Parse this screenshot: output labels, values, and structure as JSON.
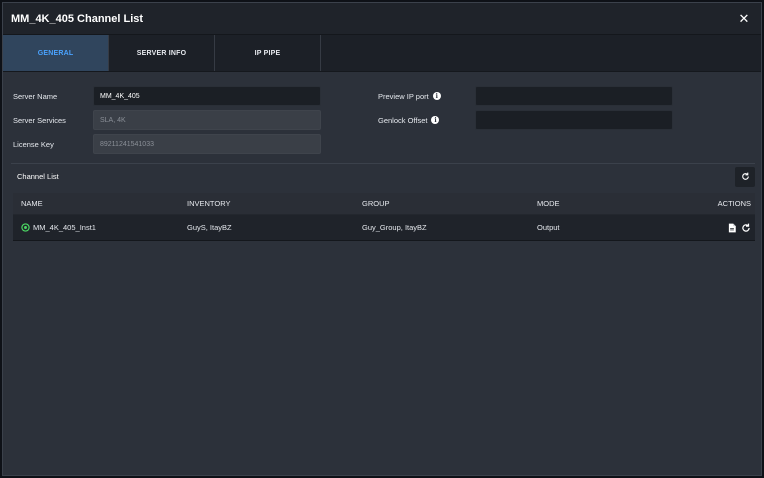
{
  "window": {
    "title": "MM_4K_405 Channel List"
  },
  "tabs": [
    {
      "label": "GENERAL",
      "active": true
    },
    {
      "label": "SERVER INFO",
      "active": false
    },
    {
      "label": "IP PIPE",
      "active": false
    }
  ],
  "form": {
    "server_name_label": "Server Name",
    "server_name_value": "MM_4K_405",
    "server_services_label": "Server Services",
    "server_services_value": "SLA, 4K",
    "license_key_label": "License Key",
    "license_key_value": "89211241541033",
    "preview_ip_label": "Preview IP port",
    "preview_ip_value": "",
    "genlock_offset_label": "Genlock Offset",
    "genlock_offset_value": ""
  },
  "channel_list": {
    "title": "Channel List",
    "columns": [
      "NAME",
      "INVENTORY",
      "GROUP",
      "MODE",
      "ACTIONS"
    ],
    "rows": [
      {
        "name": "MM_4K_405_Inst1",
        "inventory": "GuyS, ItayBZ",
        "group": "Guy_Group, ItayBZ",
        "mode": "Output",
        "status": "online"
      }
    ]
  },
  "colors": {
    "accent": "#4aa3ff",
    "status_ok": "#4cd964",
    "bg": "#2c313a"
  },
  "icons": {
    "close": "close-icon",
    "info": "info-icon",
    "refresh": "refresh-icon",
    "document": "document-icon",
    "status": "status-online-icon"
  }
}
